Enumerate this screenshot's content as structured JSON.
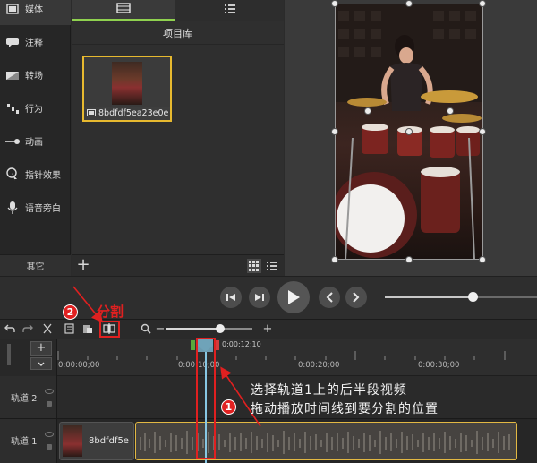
{
  "sidebar": {
    "items": [
      {
        "label": "媒体",
        "icon": "film-icon"
      },
      {
        "label": "注释",
        "icon": "annotation-icon"
      },
      {
        "label": "转场",
        "icon": "transition-icon"
      },
      {
        "label": "行为",
        "icon": "behavior-icon"
      },
      {
        "label": "动画",
        "icon": "animation-icon"
      },
      {
        "label": "指针效果",
        "icon": "cursor-effect-icon"
      },
      {
        "label": "语音旁白",
        "icon": "microphone-icon"
      }
    ],
    "other_label": "其它"
  },
  "media_panel": {
    "tabs": [
      {
        "icon": "film-icon"
      },
      {
        "icon": "list-icon"
      }
    ],
    "title": "项目库",
    "clip_name": "8bdfdf5ea23e0e",
    "add_label": "+"
  },
  "timeline": {
    "time_labels": [
      "0:00:00;00",
      "0:00:10;00",
      "0:00:20;00",
      "0:00:30;00"
    ],
    "playhead_time": "0:00:12;10",
    "tracks": [
      {
        "label": "轨道 2"
      },
      {
        "label": "轨道 1",
        "clip_name": "8bdfdf5e"
      }
    ],
    "zoom_minus": "−",
    "zoom_plus": "+",
    "add_track": "+"
  },
  "annotations": {
    "badge1": "1",
    "badge2": "2",
    "split_label": "分割",
    "line1": "选择轨道1上的后半段视频",
    "line2": "拖动播放时间线到要分割的位置",
    "color": "#e02020"
  }
}
